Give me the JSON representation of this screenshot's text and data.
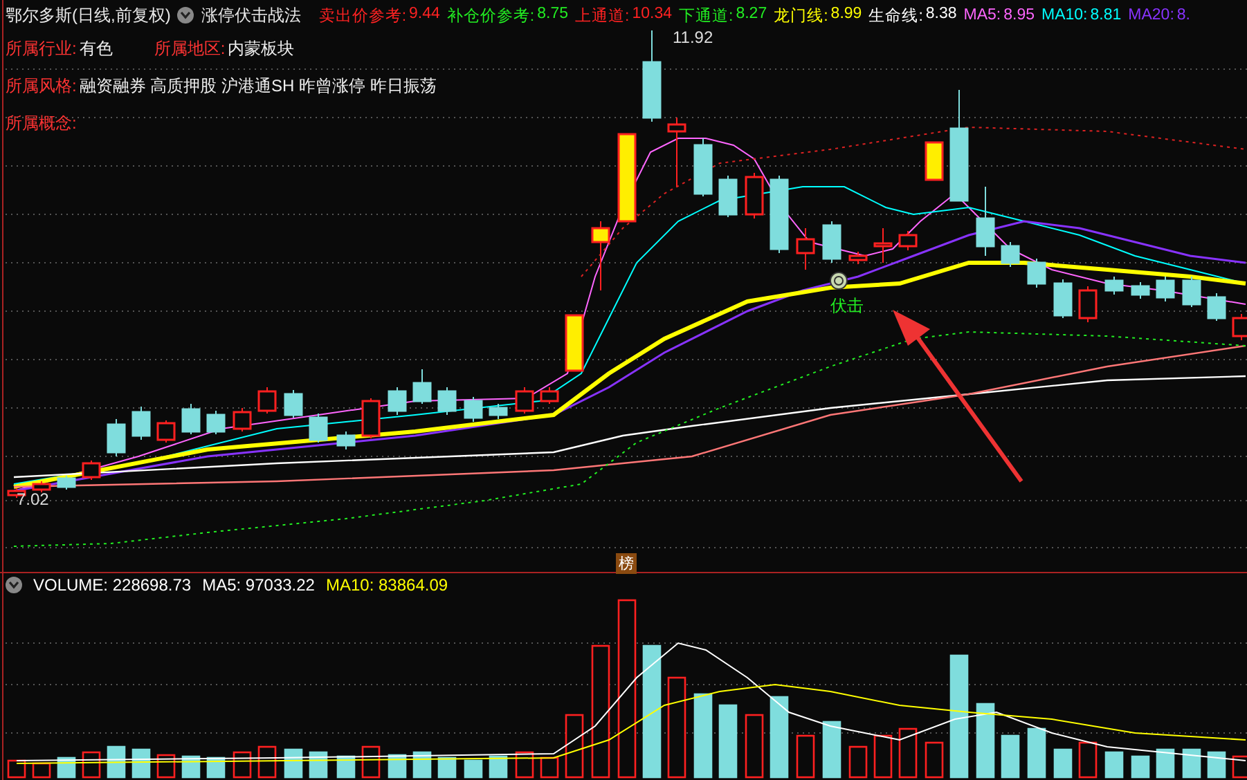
{
  "title": {
    "stock": "鄂尔多斯(日线,前复权)",
    "strategy": "涨停伏击战法"
  },
  "indicators": [
    {
      "label": "卖出价参考:",
      "value": "9.44",
      "color": "#ff2222"
    },
    {
      "label": "补仓价参考:",
      "value": "8.75",
      "color": "#22ee22"
    },
    {
      "label": "上通道:",
      "value": "10.34",
      "color": "#ff2222"
    },
    {
      "label": "下通道:",
      "value": "8.27",
      "color": "#22ee22"
    },
    {
      "label": "龙门线:",
      "value": "8.99",
      "color": "#ffff00"
    },
    {
      "label": "生命线:",
      "value": "8.38",
      "color": "#ffffff"
    },
    {
      "label": "MA5:",
      "value": "8.95",
      "color": "#ff66ff"
    },
    {
      "label": "MA10:",
      "value": "8.81",
      "color": "#00ffff"
    },
    {
      "label": "MA20:",
      "value": "8.",
      "color": "#8833ff"
    }
  ],
  "info_rows": [
    {
      "items": [
        {
          "label": "所属行业:",
          "value": "有色"
        },
        {
          "label": "所属地区:",
          "value": "内蒙板块"
        }
      ]
    },
    {
      "items": [
        {
          "label": "所属风格:",
          "value": "融资融券 高质押股 沪港通SH 昨曾涨停 昨日振荡"
        }
      ]
    },
    {
      "items": [
        {
          "label": "所属概念:"
        }
      ]
    }
  ],
  "chart": {
    "high_label": "11.92",
    "low_label": "7.02",
    "signal": "伏击",
    "badge": "榜"
  },
  "volume": [
    {
      "label": "VOLUME:",
      "value": "228698.73",
      "color": "#ffffff"
    },
    {
      "label": "MA5:",
      "value": "97033.22",
      "color": "#ffffff"
    },
    {
      "label": "MA10:",
      "value": "83864.09",
      "color": "#ffff00"
    }
  ]
}
